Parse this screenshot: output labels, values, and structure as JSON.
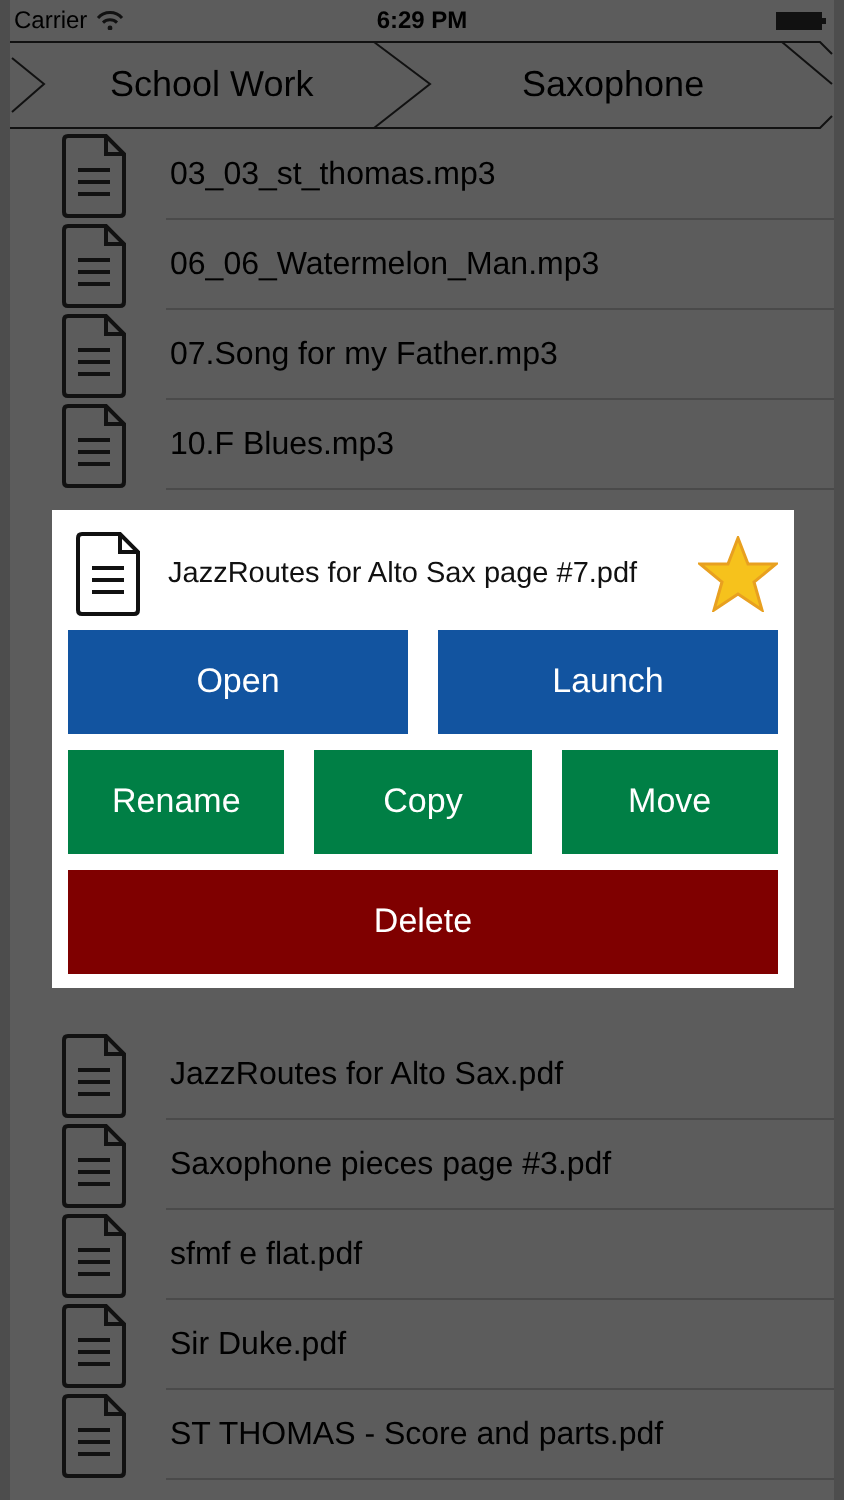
{
  "status_bar": {
    "carrier": "Carrier",
    "time": "6:29 PM"
  },
  "breadcrumbs": [
    "School Work",
    "Saxophone"
  ],
  "files_above": [
    {
      "name": "03_03_st_thomas.mp3"
    },
    {
      "name": "06_06_Watermelon_Man.mp3"
    },
    {
      "name": "07.Song for my Father.mp3"
    },
    {
      "name": "10.F Blues.mp3"
    }
  ],
  "files_below": [
    {
      "name": "JazzRoutes for Alto Sax.pdf"
    },
    {
      "name": "Saxophone pieces page #3.pdf"
    },
    {
      "name": "sfmf e flat.pdf"
    },
    {
      "name": "Sir Duke.pdf"
    },
    {
      "name": "ST THOMAS - Score and parts.pdf"
    }
  ],
  "popup": {
    "title": "JazzRoutes for Alto Sax page #7.pdf",
    "favorite": true,
    "actions": [
      {
        "label": "Open",
        "kind": "primary"
      },
      {
        "label": "Launch",
        "kind": "primary"
      },
      {
        "label": "Rename",
        "kind": "secondary"
      },
      {
        "label": "Copy",
        "kind": "secondary"
      },
      {
        "label": "Move",
        "kind": "secondary"
      },
      {
        "label": "Delete",
        "kind": "danger"
      }
    ]
  }
}
